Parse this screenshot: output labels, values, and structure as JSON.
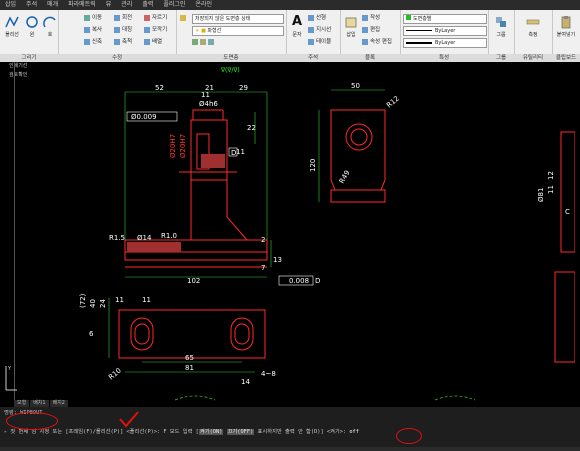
{
  "ribbon_tabs": [
    "삽입",
    "주석",
    "매개",
    "파라메트릭",
    "뷰",
    "관리",
    "출력",
    "플러그인",
    "온라인"
  ],
  "ribbon": {
    "draw": {
      "label": "그리기",
      "polyline": "폴리선",
      "circle": "원",
      "arc": "호"
    },
    "modify": {
      "label": "수정",
      "move": "이동",
      "rotate": "회전",
      "trim": "자르기",
      "copy": "복사",
      "mirror": "대칭",
      "fillet": "모깍기",
      "stretch": "신축",
      "scale": "축척",
      "array": "배열"
    },
    "layers": {
      "label": "도면층",
      "state": "저장되지 않은 도면층 상태",
      "current": "파형선"
    },
    "annotation": {
      "label": "주석",
      "text": "문자",
      "dim_linear": "선형",
      "leader": "지시선",
      "table": "테이블"
    },
    "block": {
      "label": "블록",
      "insert": "삽입",
      "create": "작성",
      "edit": "편집",
      "attr_edit": "속성 편집"
    },
    "properties": {
      "label": "특성",
      "color": "도면층별",
      "linetype": "ByLayer",
      "lineweight": "ByLayer"
    },
    "groups": {
      "label": "그룹",
      "group": "그룹"
    },
    "utilities": {
      "label": "유틸리티",
      "measure": "측정"
    },
    "clipboard": {
      "label": "클립보드",
      "paste": "붙여넣기"
    }
  },
  "side_labels": [
    "인쇄기선",
    "검토확인"
  ],
  "drawing": {
    "view_label": "∇(∇/∇)",
    "dims_front": {
      "d52": "52",
      "d21": "21",
      "d29": "29",
      "d11": "11",
      "d4h6": "Ø4h6",
      "d22": "22",
      "d11b": "11",
      "tol": "Ø0.009",
      "datumD": "D",
      "d20h7": "Ø20H7",
      "d20h7b": "Ø20H7",
      "r15": "R1.5",
      "d14": "Ø14",
      "r10": "R1.0",
      "d102": "102",
      "d13": "13",
      "d2": "2",
      "d7": "7",
      "flat": "0.008",
      "flatD": "D"
    },
    "dims_side": {
      "d50": "50",
      "r12": "R12",
      "r49": "R49",
      "d120": "120"
    },
    "dims_bottom": {
      "d72": "(72)",
      "d40": "40",
      "d24": "24",
      "d6": "6",
      "d11": "11",
      "d11b": "11",
      "d65": "65",
      "d81": "81",
      "r10": "R10",
      "d14": "14",
      "d48": "4~8"
    },
    "dims_right": {
      "d81": "Ø81",
      "d12": "12",
      "d11": "11",
      "c": "C"
    }
  },
  "layout_tabs": [
    "모형",
    "배치1",
    "배치2"
  ],
  "command": {
    "history": "명령: WIPEOUT",
    "prompt_start": "첫 번째 점 지정 또는 [프레임(F)/폴리선(P)] <폴리선(P)>: F 모드 입력 [",
    "opt1": "켜기(ON)",
    "sep1": " ",
    "opt2": "끄기(OFF)",
    "prompt_mid": " 표시하지만 출력 안 함(D)] <켜기>:",
    "input": "off"
  }
}
